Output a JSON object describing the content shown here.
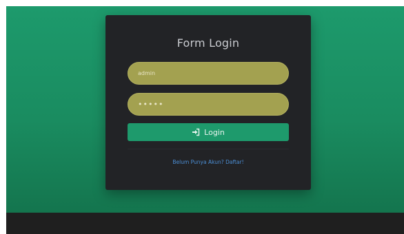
{
  "login_form": {
    "title": "Form Login",
    "username_value": "admin",
    "password_value": "•••••",
    "login_label": "Login",
    "register_link": "Belum Punya Akun? Daftar!"
  },
  "colors": {
    "background_green": "#1d9a6c",
    "card": "#222326",
    "input_fill": "#a3a150",
    "button": "#1e9a6c",
    "link": "#4c8fd6",
    "footer": "#1f1f1f"
  },
  "icons": {
    "login": "sign-in-icon"
  }
}
